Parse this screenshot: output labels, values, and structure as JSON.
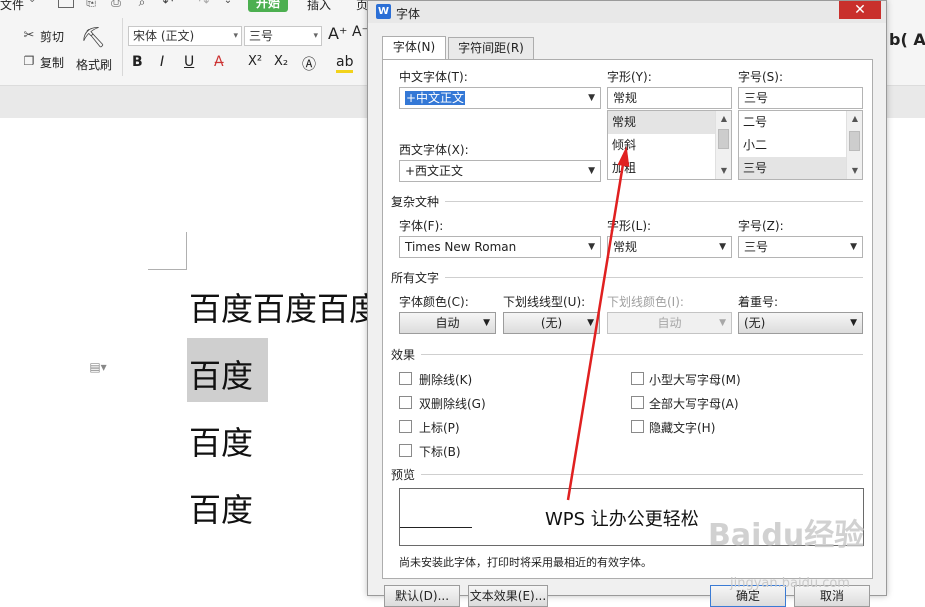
{
  "ribbon": {
    "file_menu": "文件",
    "start_tab": "开始",
    "insert_tab": "插入",
    "page_tab_partial": "页",
    "cut": "剪切",
    "copy": "复制",
    "format_painter": "格式刷",
    "font_name": "宋体 (正文)",
    "font_size": "三号",
    "bold": "B",
    "italic": "I",
    "underline": "U",
    "style_partial": "b( Aa"
  },
  "document": {
    "lines": [
      "百度百度百度",
      "百度",
      "百度",
      "百度"
    ]
  },
  "dialog": {
    "title": "字体",
    "close": "✕",
    "tabs": [
      "字体(N)",
      "字符间距(R)"
    ],
    "cn_font_label": "中文字体(T):",
    "cn_font_value": "+中文正文",
    "style_label": "字形(Y):",
    "style_value": "常规",
    "style_list": [
      "常规",
      "倾斜",
      "加粗"
    ],
    "size_label": "字号(S):",
    "size_value": "三号",
    "size_list": [
      "二号",
      "小二",
      "三号"
    ],
    "west_font_label": "西文字体(X):",
    "west_font_value": "+西文正文",
    "complex_section": "复杂文种",
    "complex_font_label": "字体(F):",
    "complex_font_value": "Times New Roman",
    "complex_style_label": "字形(L):",
    "complex_style_value": "常规",
    "complex_size_label": "字号(Z):",
    "complex_size_value": "三号",
    "all_text_section": "所有文字",
    "font_color_label": "字体颜色(C):",
    "font_color_value": "自动",
    "underline_type_label": "下划线线型(U):",
    "underline_type_value": "(无)",
    "underline_color_label": "下划线颜色(I):",
    "underline_color_value": "自动",
    "emphasis_label": "着重号:",
    "emphasis_value": "(无)",
    "effects_section": "效果",
    "effects_left": [
      "删除线(K)",
      "双删除线(G)",
      "上标(P)",
      "下标(B)"
    ],
    "effects_right": [
      "小型大写字母(M)",
      "全部大写字母(A)",
      "隐藏文字(H)"
    ],
    "preview_section": "预览",
    "preview_text": "WPS 让办公更轻松",
    "note": "尚未安装此字体，打印时将采用最相近的有效字体。",
    "bottom_buttons": [
      "默认(D)...",
      "文本效果(E)...",
      "确定",
      "取消"
    ]
  },
  "watermark": {
    "brand": "Baidu经验",
    "url": "jingyan.baidu.com"
  },
  "colors": {
    "start_tab_bg": "#4caf50",
    "close_red": "#c9302c",
    "annotation_arrow": "#e02020",
    "selection_blue": "#3478d6"
  }
}
